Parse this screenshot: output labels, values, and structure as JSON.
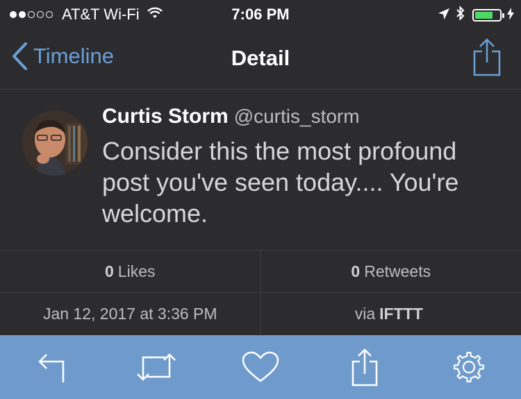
{
  "status_bar": {
    "carrier": "AT&T Wi-Fi",
    "time": "7:06 PM",
    "signal_bars_filled": 2,
    "signal_bars_total": 5,
    "battery_level_percent": 75,
    "icons": [
      "wifi-icon",
      "location-arrow-icon",
      "bluetooth-icon",
      "battery-icon",
      "charging-bolt-icon"
    ]
  },
  "nav": {
    "back_label": "Timeline",
    "title": "Detail",
    "share_icon": "share-icon"
  },
  "tweet": {
    "author_name": "Curtis Storm",
    "author_handle": "@curtis_storm",
    "text": "Consider this the most profound post you've seen today.... You're welcome.",
    "likes_count": "0",
    "likes_label": "Likes",
    "retweets_count": "0",
    "retweets_label": "Retweets",
    "timestamp": "Jan 12, 2017 at 3:36 PM",
    "via_prefix": "via",
    "via_source": "IFTTT"
  },
  "toolbar": {
    "items": [
      "reply-icon",
      "retweet-icon",
      "like-icon",
      "share-icon",
      "settings-icon"
    ]
  },
  "colors": {
    "background": "#2c2c2e",
    "accent": "#6a9fd8",
    "toolbar": "#6f9bcc",
    "battery": "#4cd964"
  }
}
